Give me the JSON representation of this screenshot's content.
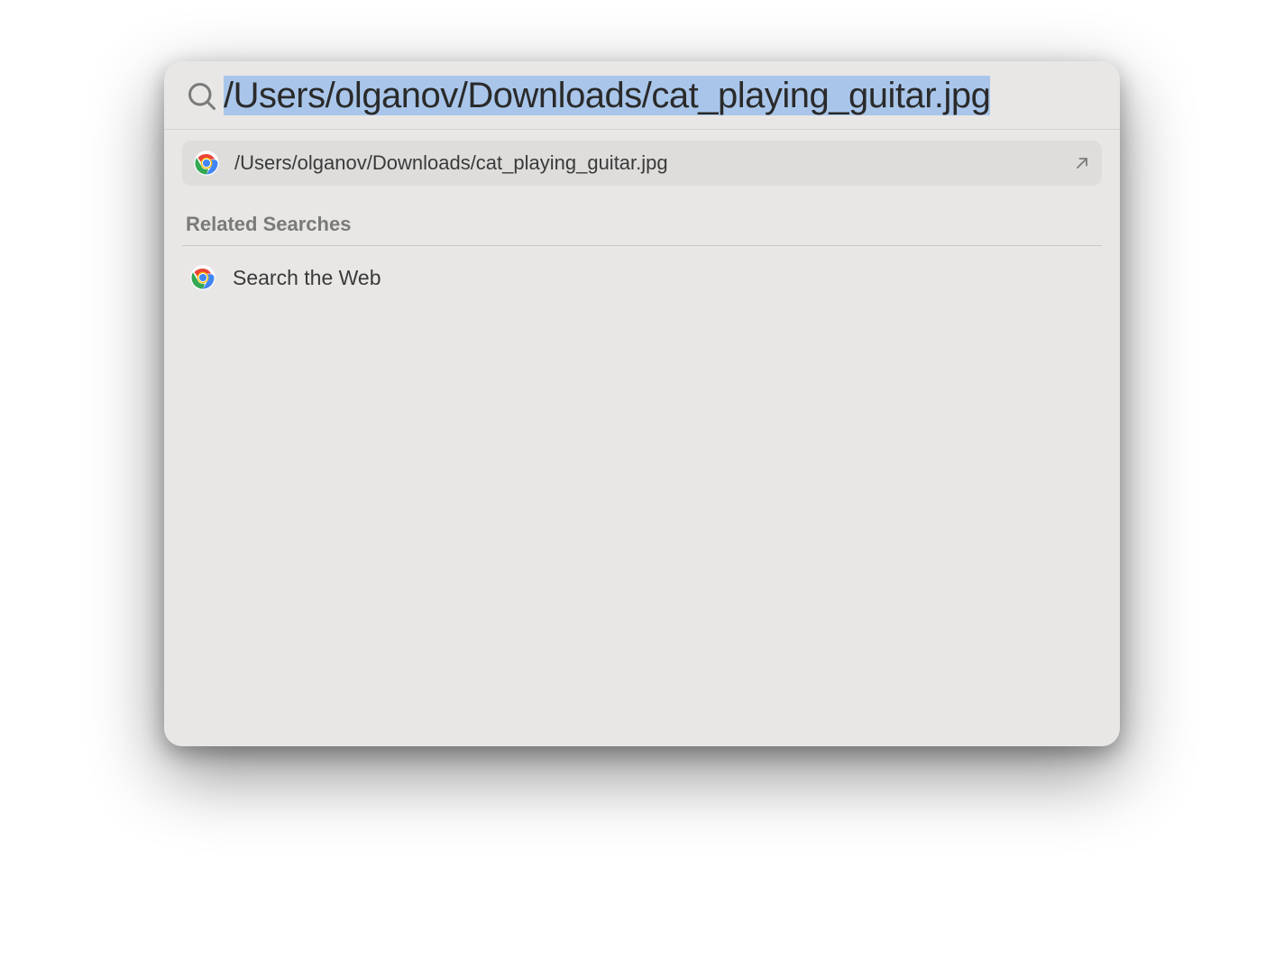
{
  "search": {
    "query_prefix": "",
    "query_selected": "/Users/olganov/Downloads/cat_playing_guitar.jpg"
  },
  "top_hit": {
    "icon": "chrome-icon",
    "label": "/Users/olganov/Downloads/cat_playing_guitar.jpg"
  },
  "sections": {
    "related_header": "Related Searches",
    "related_items": [
      {
        "icon": "chrome-icon",
        "label": "Search the Web"
      }
    ]
  }
}
